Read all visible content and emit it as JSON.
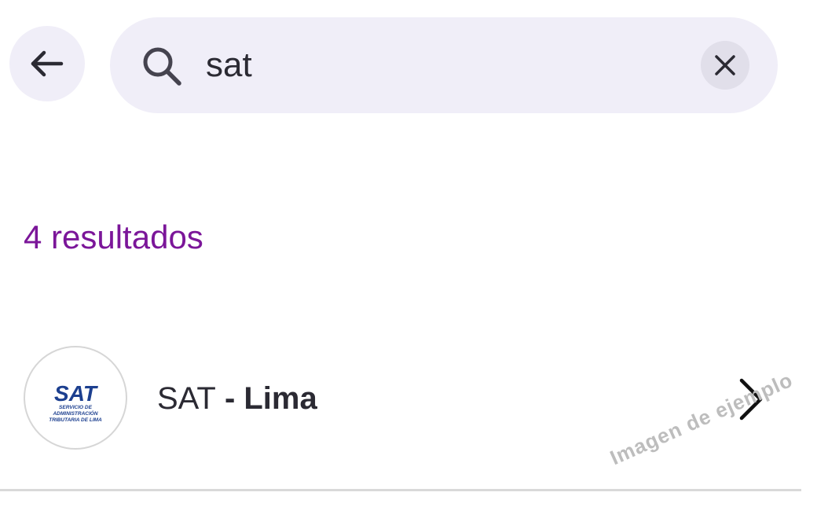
{
  "search": {
    "query": "sat",
    "back_icon": "arrow-left-icon",
    "search_icon": "magnifier-icon",
    "clear_icon": "close-icon"
  },
  "results": {
    "count_label": "4 resultados",
    "items": [
      {
        "name": "SAT",
        "separator": " - ",
        "location": "Lima",
        "logo": {
          "acronym": "SAT",
          "line1": "SERVICIO DE",
          "line2": "ADMINISTRACIÓN",
          "line3": "TRIBUTARIA DE LIMA"
        },
        "chevron_icon": "chevron-right-icon"
      }
    ]
  },
  "watermark": "Imagen de ejemplo",
  "colors": {
    "accent": "#7b1699",
    "search_bg": "#f0eef8",
    "text": "#2b2a33",
    "logo_blue": "#1c3f8f"
  }
}
